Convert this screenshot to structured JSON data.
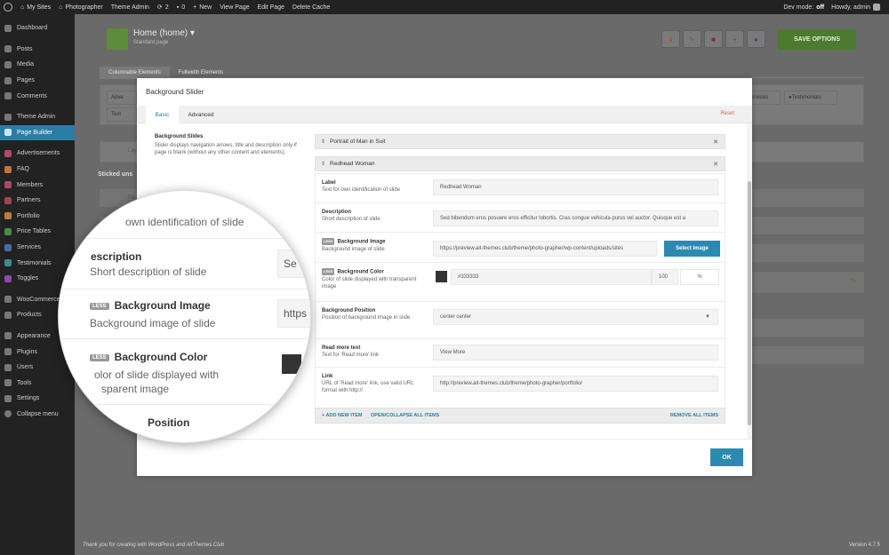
{
  "adminbar": {
    "my_sites": "My Sites",
    "site_name": "Photographer",
    "theme_admin": "Theme Admin",
    "updates_count": "2",
    "comments_count": "0",
    "new": "New",
    "view_page": "View Page",
    "edit_page": "Edit Page",
    "delete_cache": "Delete Cache",
    "dev_mode_label": "Dev mode:",
    "dev_mode_value": "off",
    "howdy": "Howdy, admin"
  },
  "sidebar": {
    "items": [
      {
        "label": "Dashboard"
      },
      {
        "label": "Posts"
      },
      {
        "label": "Media"
      },
      {
        "label": "Pages"
      },
      {
        "label": "Comments"
      },
      {
        "label": "Theme Admin"
      },
      {
        "label": "Page Builder"
      },
      {
        "label": "Advertisements"
      },
      {
        "label": "FAQ"
      },
      {
        "label": "Members"
      },
      {
        "label": "Partners"
      },
      {
        "label": "Portfolio"
      },
      {
        "label": "Price Tables"
      },
      {
        "label": "Services"
      },
      {
        "label": "Testimonials"
      },
      {
        "label": "Toggles"
      },
      {
        "label": "WooCommerce"
      },
      {
        "label": "Products"
      },
      {
        "label": "Appearance"
      },
      {
        "label": "Plugins"
      },
      {
        "label": "Users"
      },
      {
        "label": "Tools"
      },
      {
        "label": "Settings"
      },
      {
        "label": "Collapse menu"
      }
    ]
  },
  "builder": {
    "title": "Home (home)",
    "subtitle": "Standard page",
    "save_label": "SAVE OPTIONS",
    "tab_columnable": "Columnable Elements",
    "tab_fullwidth": "Fullwidth Elements",
    "adv_fragment": "Adve",
    "text_fragment": "Text",
    "lay_fragment": "Lay",
    "sticked_fragment": "Sticked uns",
    "pa_fragment": "Pa",
    "services_tag": "Services",
    "testimonials_tag": "Testimonials"
  },
  "footer": {
    "thanks_pre": "Thank you for creating with",
    "wordpress": "WordPress",
    "and": "and",
    "aitthemes": "AitThemes.Club",
    "version": "Version 4.7.5"
  },
  "modal": {
    "title": "Background Slider",
    "tab_basic": "Basic",
    "tab_advanced": "Advanced",
    "reset": "Reset",
    "section_title": "Background Slides",
    "section_desc": "Slider displays navigation arrows, title and description only if page is blank (without any other content and elements).",
    "item1_title": "Portrait of Man in Suit",
    "item2_title": "Redhead Woman",
    "fields": {
      "label": {
        "title": "Label",
        "desc": "Text for own identification of slide",
        "value": "Redhead Woman"
      },
      "description": {
        "title": "Description",
        "desc": "Short description of slide",
        "value": "Sed bibendum eros posuere eros efficitur lobortis. Cras congue vehicula purus vel auctor. Quisque est a"
      },
      "bg_image": {
        "badge": "LESS",
        "title": "Background Image",
        "desc": "Background image of slide",
        "value": "https://preview.ait-themes.club/theme/photo-grapher/wp-content/uploads/sites",
        "button": "Select Image"
      },
      "bg_color": {
        "badge": "LESS",
        "title": "Background Color",
        "desc": "Color of slide displayed with transparent image",
        "value": "#333333",
        "opacity": "100",
        "percent": "%"
      },
      "bg_position": {
        "title": "Background Position",
        "desc": "Position of background image in slide",
        "value": "center center"
      },
      "read_more": {
        "title": "Read more text",
        "desc": "Text for 'Read more' link",
        "value": "View More"
      },
      "link": {
        "title": "Link",
        "desc": "URL of 'Read more' link, use valid URL format with http://",
        "value": "http://preview.ait-themes.club/theme/photo-grapher/portfolio/"
      }
    },
    "add_new": "+ ADD NEW ITEM",
    "open_collapse": "OPEN/COLLAPSE ALL ITEMS",
    "remove_all": "REMOVE ALL ITEMS",
    "ok": "OK"
  },
  "magnifier": {
    "label_desc_frag": "own identification of slide",
    "description_title_frag": "escription",
    "description_desc_frag": "Short description of slide",
    "description_value_frag": "Se",
    "bg_image_badge": "LESS",
    "bg_image_title": "Background Image",
    "bg_image_desc": "Background image of slide",
    "bg_image_value_frag": "https",
    "bg_color_badge": "LESS",
    "bg_color_title": "Background Color",
    "bg_color_desc1": "olor of slide displayed with",
    "bg_color_desc2": "sparent image",
    "position_frag": "Position"
  },
  "colors": {
    "accent": "#2c8ab0",
    "save_green": "#4c7a2f",
    "swatch": "#333333",
    "reset_red": "#cc6666"
  }
}
